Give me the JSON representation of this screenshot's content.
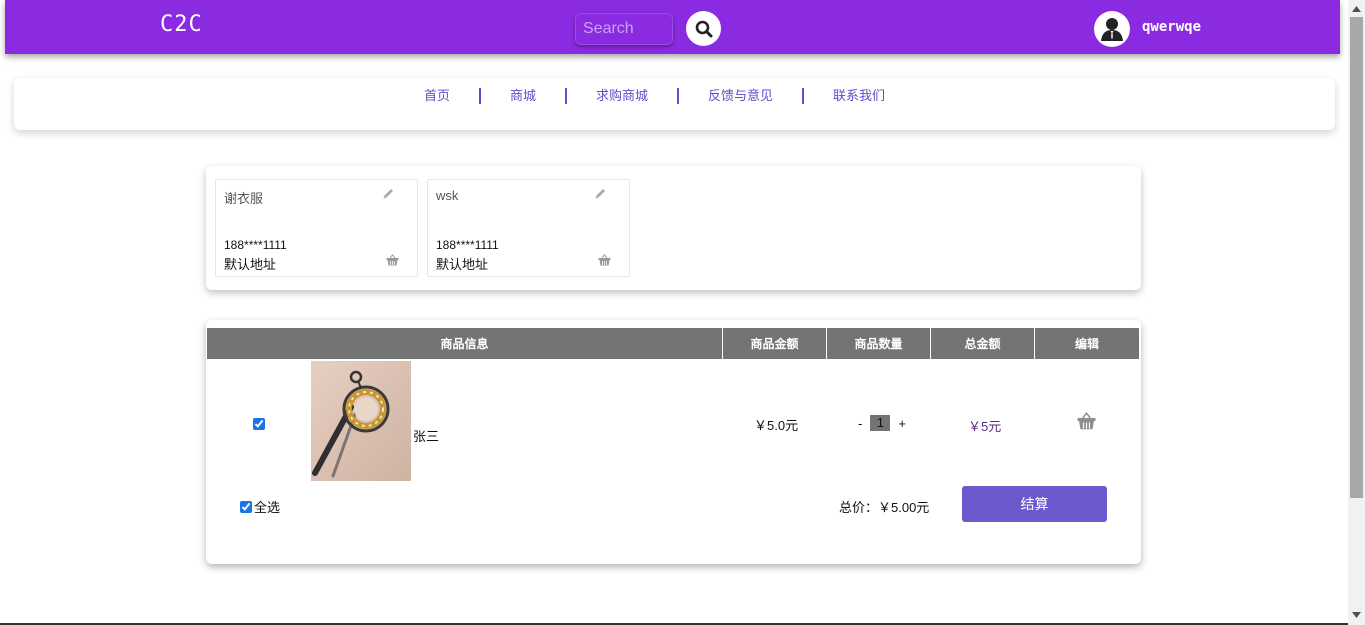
{
  "header": {
    "brand": "C2C",
    "search_placeholder": "Search",
    "username": "qwerwqe",
    "color": "#8a2be2"
  },
  "nav": {
    "items": [
      "首页",
      "商城",
      "求购商城",
      "反馈与意见",
      "联系我们"
    ]
  },
  "addresses": [
    {
      "name": "谢衣服",
      "phone": "188****1111",
      "tag": "默认地址"
    },
    {
      "name": "wsk",
      "phone": "188****1111",
      "tag": "默认地址"
    }
  ],
  "cart": {
    "headers": [
      "商品信息",
      "商品金额",
      "商品数量",
      "总金额",
      "编辑"
    ],
    "items": [
      {
        "name": "张三",
        "price": "￥5.0元",
        "quantity": "1",
        "total": "￥5元",
        "checked": true
      }
    ],
    "minus": "-",
    "plus": "+",
    "select_all": "全选",
    "sum_label": "总价：￥5.00元",
    "checkout_label": "结算",
    "accent": "#6a5acd"
  },
  "icons": {
    "search": "search-icon",
    "avatar": "user-avatar-icon",
    "edit": "pencil-icon",
    "delete": "basket-icon"
  }
}
